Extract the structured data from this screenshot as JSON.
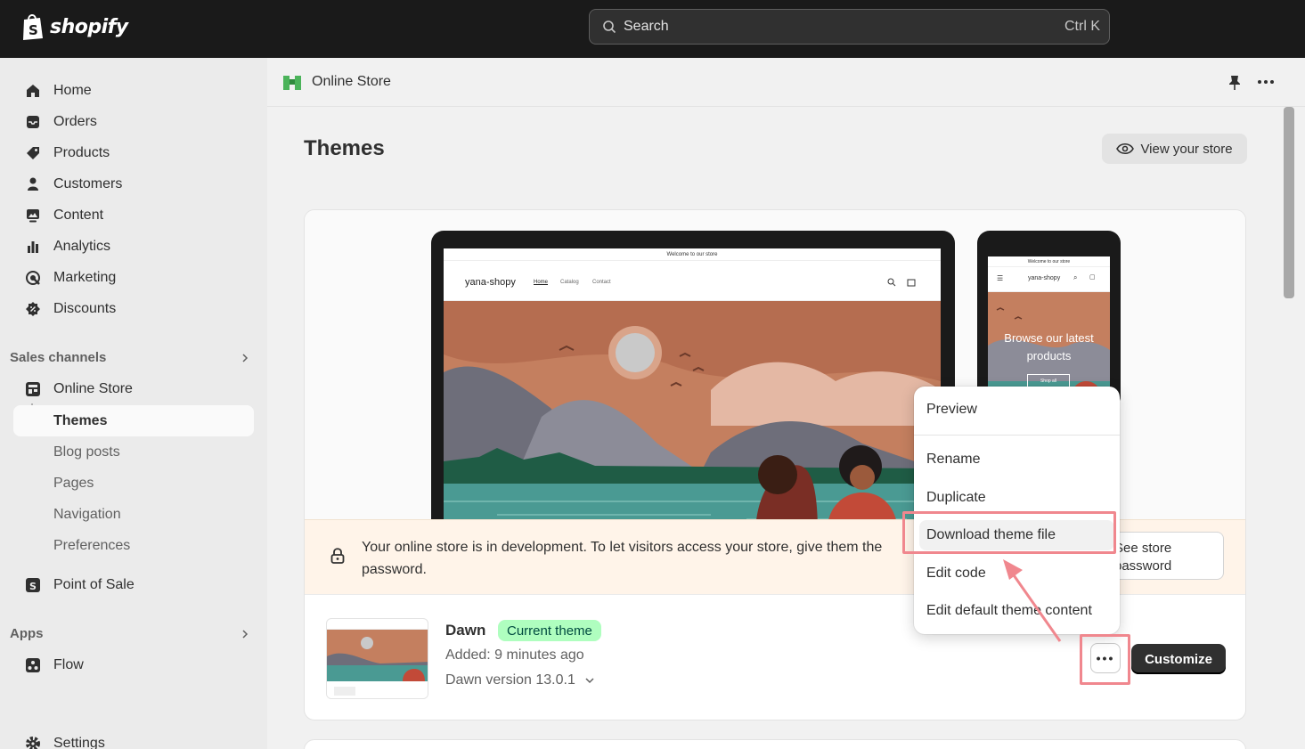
{
  "topbar": {
    "brand": "shopify",
    "search_placeholder": "Search",
    "search_shortcut": "Ctrl K"
  },
  "sidebar": {
    "items": [
      {
        "label": "Home",
        "icon": "home-icon"
      },
      {
        "label": "Orders",
        "icon": "inbox-icon"
      },
      {
        "label": "Products",
        "icon": "tag-icon"
      },
      {
        "label": "Customers",
        "icon": "person-icon"
      },
      {
        "label": "Content",
        "icon": "image-icon"
      },
      {
        "label": "Analytics",
        "icon": "bar-chart-icon"
      },
      {
        "label": "Marketing",
        "icon": "target-icon"
      },
      {
        "label": "Discounts",
        "icon": "discount-icon"
      }
    ],
    "sales_channels_label": "Sales channels",
    "online_store_label": "Online Store",
    "online_store_sub": [
      "Themes",
      "Blog posts",
      "Pages",
      "Navigation",
      "Preferences"
    ],
    "pos_label": "Point of Sale",
    "apps_label": "Apps",
    "flow_label": "Flow",
    "settings_label": "Settings"
  },
  "header": {
    "title": "Online Store"
  },
  "page": {
    "title": "Themes",
    "view_store_label": "View your store"
  },
  "store_preview": {
    "announcement": "Welcome to our store",
    "store_name": "yana-shopy",
    "nav": [
      "Home",
      "Catalog",
      "Contact"
    ],
    "mobile_hero": "Browse our latest products",
    "mobile_button": "Shop all"
  },
  "banner": {
    "text": "Your online store is in development. To let visitors access your store, give them the password.",
    "button_label": "See store password"
  },
  "theme": {
    "name": "Dawn",
    "badge": "Current theme",
    "added": "Added: 9 minutes ago",
    "version": "Dawn version 13.0.1",
    "more_label": "•••",
    "customize_label": "Customize"
  },
  "menu": {
    "items": [
      "Preview",
      "Rename",
      "Duplicate",
      "Download theme file",
      "Edit code",
      "Edit default theme content"
    ]
  },
  "colors": {
    "topbar": "#1a1a1a",
    "highlight": "#f0878e",
    "badge_bg": "#affebf",
    "banner_bg": "#fff4e9"
  }
}
